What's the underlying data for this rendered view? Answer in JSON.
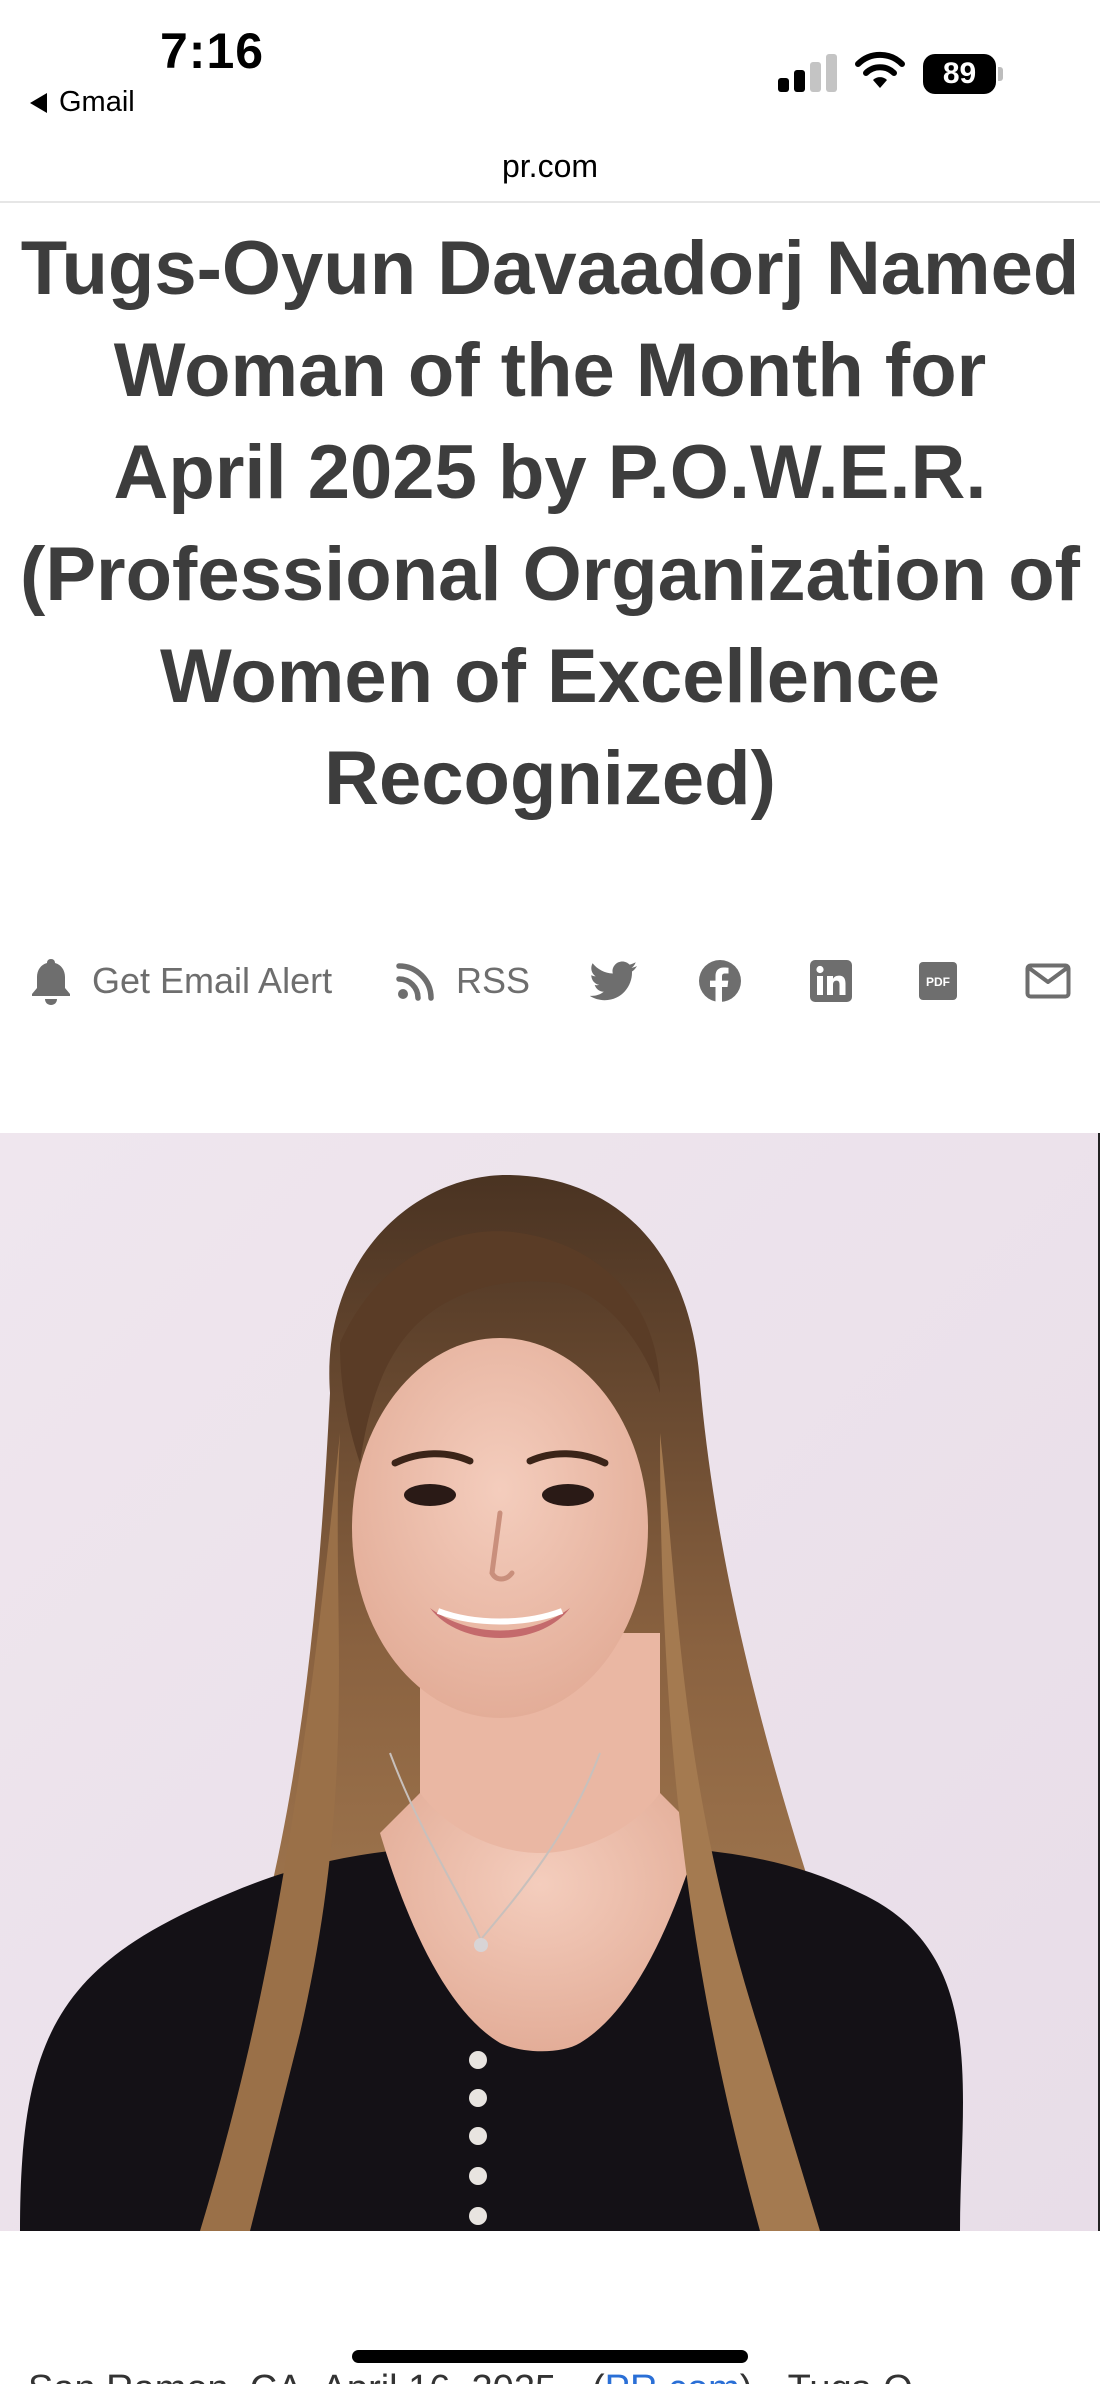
{
  "status_bar": {
    "time": "7:16",
    "back_app": "Gmail",
    "battery": "89"
  },
  "browser": {
    "url": "pr.com"
  },
  "article": {
    "headline": "Tugs-Oyun Davaadorj Named Woman of the Month for April 2025 by P.O.W.E.R. (Professional Organization of Women of Excellence Recognized)",
    "dateline_start": "San Ramon, CA, April 16, 2025 --(",
    "dateline_link": "PR.com",
    "dateline_end": ")-- Tugs-O"
  },
  "share_bar": {
    "email_alert_label": "Get Email Alert",
    "rss_label": "RSS",
    "icons": [
      "bell-icon",
      "rss-icon",
      "twitter-icon",
      "facebook-icon",
      "linkedin-icon",
      "pdf-icon",
      "mail-icon"
    ]
  },
  "colors": {
    "headline": "#3d3d3d",
    "share_icons": "#6e6e6e",
    "link": "#2a6fd6",
    "photo_background": "#ece3ec"
  }
}
